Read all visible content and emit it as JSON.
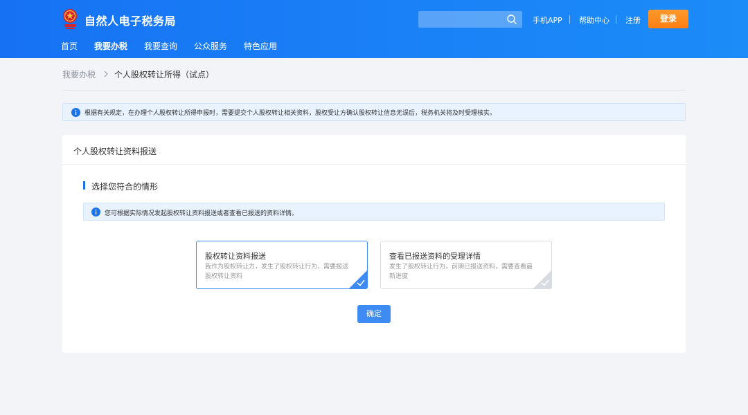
{
  "header": {
    "site_title": "自然人电子税务局",
    "search": {
      "value": "",
      "placeholder": ""
    },
    "links": [
      "手机APP",
      "帮助中心",
      "注册"
    ],
    "login_label": "登录"
  },
  "nav": {
    "items": [
      {
        "label": "首页",
        "active": false
      },
      {
        "label": "我要办税",
        "active": true
      },
      {
        "label": "我要查询",
        "active": false
      },
      {
        "label": "公众服务",
        "active": false
      },
      {
        "label": "特色应用",
        "active": false
      }
    ]
  },
  "breadcrumb": {
    "parent": "我要办税",
    "current": "个人股权转让所得（试点）"
  },
  "notice": {
    "text": "根据有关规定，在办理个人股权转让所得申报时，需要提交个人股权转让相关资料，股权受让方确认股权转让信息无误后，税务机关将及时受理核实。"
  },
  "card": {
    "title": "个人股权转让资料报送",
    "section_title": "选择您符合的情形",
    "sub_notice": "您可根据实际情况发起股权转让资料报送或者查看已报送的资料详情。",
    "options": [
      {
        "title": "股权转让资料报送",
        "desc": "我作为股权转让方，发生了股权转让行为，需要报送股权转让资料",
        "selected": true
      },
      {
        "title": "查看已报送资料的受理详情",
        "desc": "发生了股权转让行为，前期已报送资料，需要查看最新进度",
        "selected": false
      }
    ],
    "confirm_label": "确定"
  },
  "colors": {
    "header_blue": "#1a7ff6",
    "login_orange": "#ff8a1f",
    "accent_blue": "#3d8bf3",
    "notice_bg": "#e8f3ff",
    "page_bg": "#f2f4f7"
  },
  "icons": {
    "logo": "tax-emblem-icon",
    "search": "search-icon",
    "info": "info-icon",
    "breadcrumb_sep": "chevron-right-icon",
    "selected_mark": "check-icon"
  }
}
